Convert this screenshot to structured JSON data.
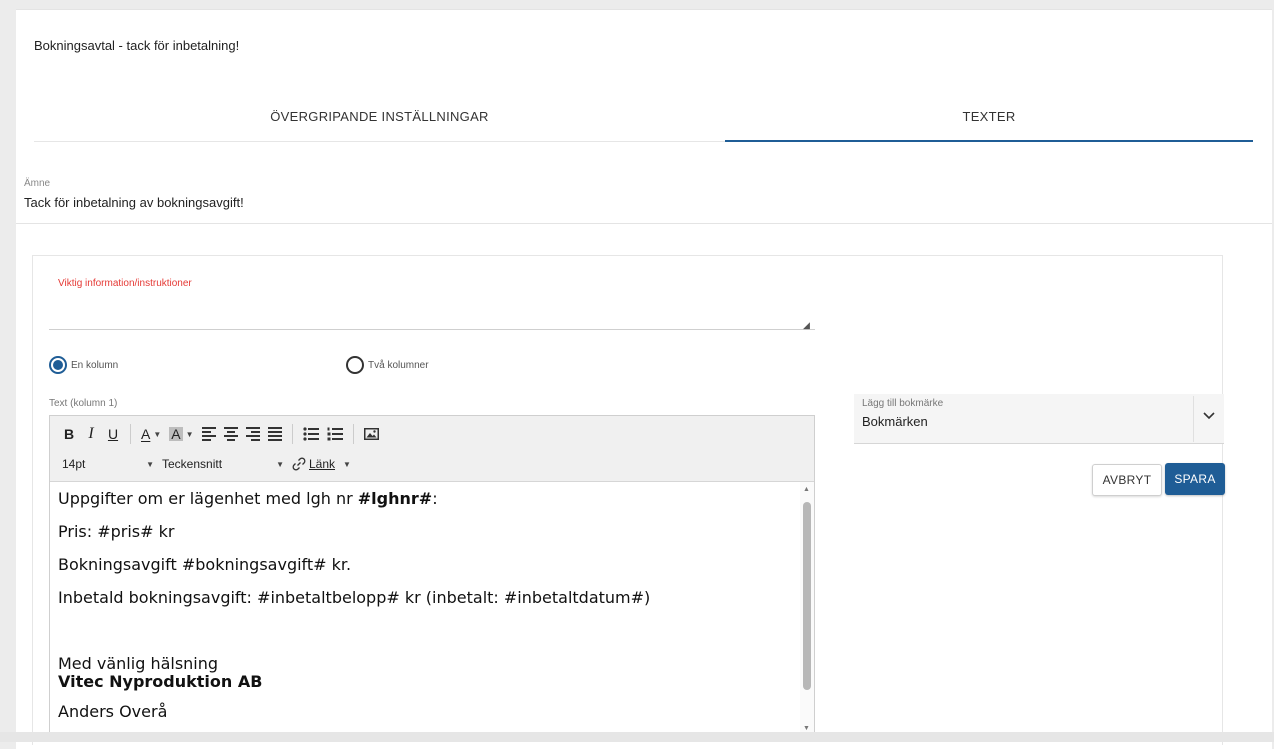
{
  "dialog": {
    "title": "Bokningsavtal - tack för inbetalning!"
  },
  "tabs": [
    {
      "label": "ÖVERGRIPANDE INSTÄLLNINGAR",
      "active": false
    },
    {
      "label": "TEXTER",
      "active": true
    }
  ],
  "subject": {
    "label": "Ämne",
    "value": "Tack för inbetalning av bokningsavgift!"
  },
  "important": {
    "label": "Viktig information/instruktioner",
    "value": ""
  },
  "columns": {
    "options": [
      {
        "label": "En kolumn",
        "selected": true
      },
      {
        "label": "Två kolumner",
        "selected": false
      }
    ]
  },
  "editor": {
    "label": "Text (kolumn 1)",
    "toolbar": {
      "bold": "B",
      "italic": "I",
      "underline": "U",
      "text_color": "A",
      "bg_color": "A",
      "font_size": "14pt",
      "font_family": "Teckensnitt",
      "link": "Länk"
    },
    "content": {
      "line1_prefix": "Uppgifter om er lägenhet med lgh nr ",
      "line1_bold": "#lghnr#",
      "line1_suffix": ":",
      "line2": "Pris: #pris# kr",
      "line3": "Bokningsavgift #bokningsavgift# kr.",
      "line4": "Inbetald bokningsavgift: #inbetaltbelopp# kr (inbetalt: #inbetaltdatum#)",
      "greeting": "Med vänlig hälsning",
      "company": "Vitec Nyproduktion AB",
      "signature": "Anders Overå"
    }
  },
  "bookmark": {
    "label": "Lägg till bokmärke",
    "value": "Bokmärken"
  },
  "actions": {
    "cancel": "AVBRYT",
    "save": "SPARA"
  },
  "colors": {
    "accent": "#1f5d96",
    "required": "#e53935"
  }
}
